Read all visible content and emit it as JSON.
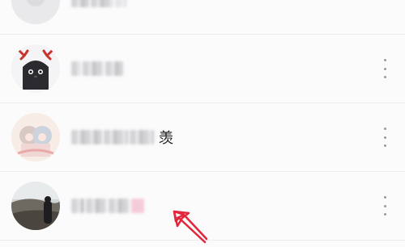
{
  "contacts": [
    {
      "avatar": "gray-circle-avatar",
      "name_visible": ""
    },
    {
      "avatar": "black-reindeer-avatar",
      "name_visible": ""
    },
    {
      "avatar": "anime-girls-avatar",
      "name_visible": "羡"
    },
    {
      "avatar": "landscape-person-avatar",
      "name_visible": ""
    }
  ],
  "icons": {
    "more": "vertical-ellipsis-icon",
    "annotation": "red-hand-drawn-arrow"
  },
  "colors": {
    "background": "#fbfbfc",
    "divider": "#ececee",
    "annotation_red": "#e3263a",
    "more_dots": "#9a9aa0"
  }
}
